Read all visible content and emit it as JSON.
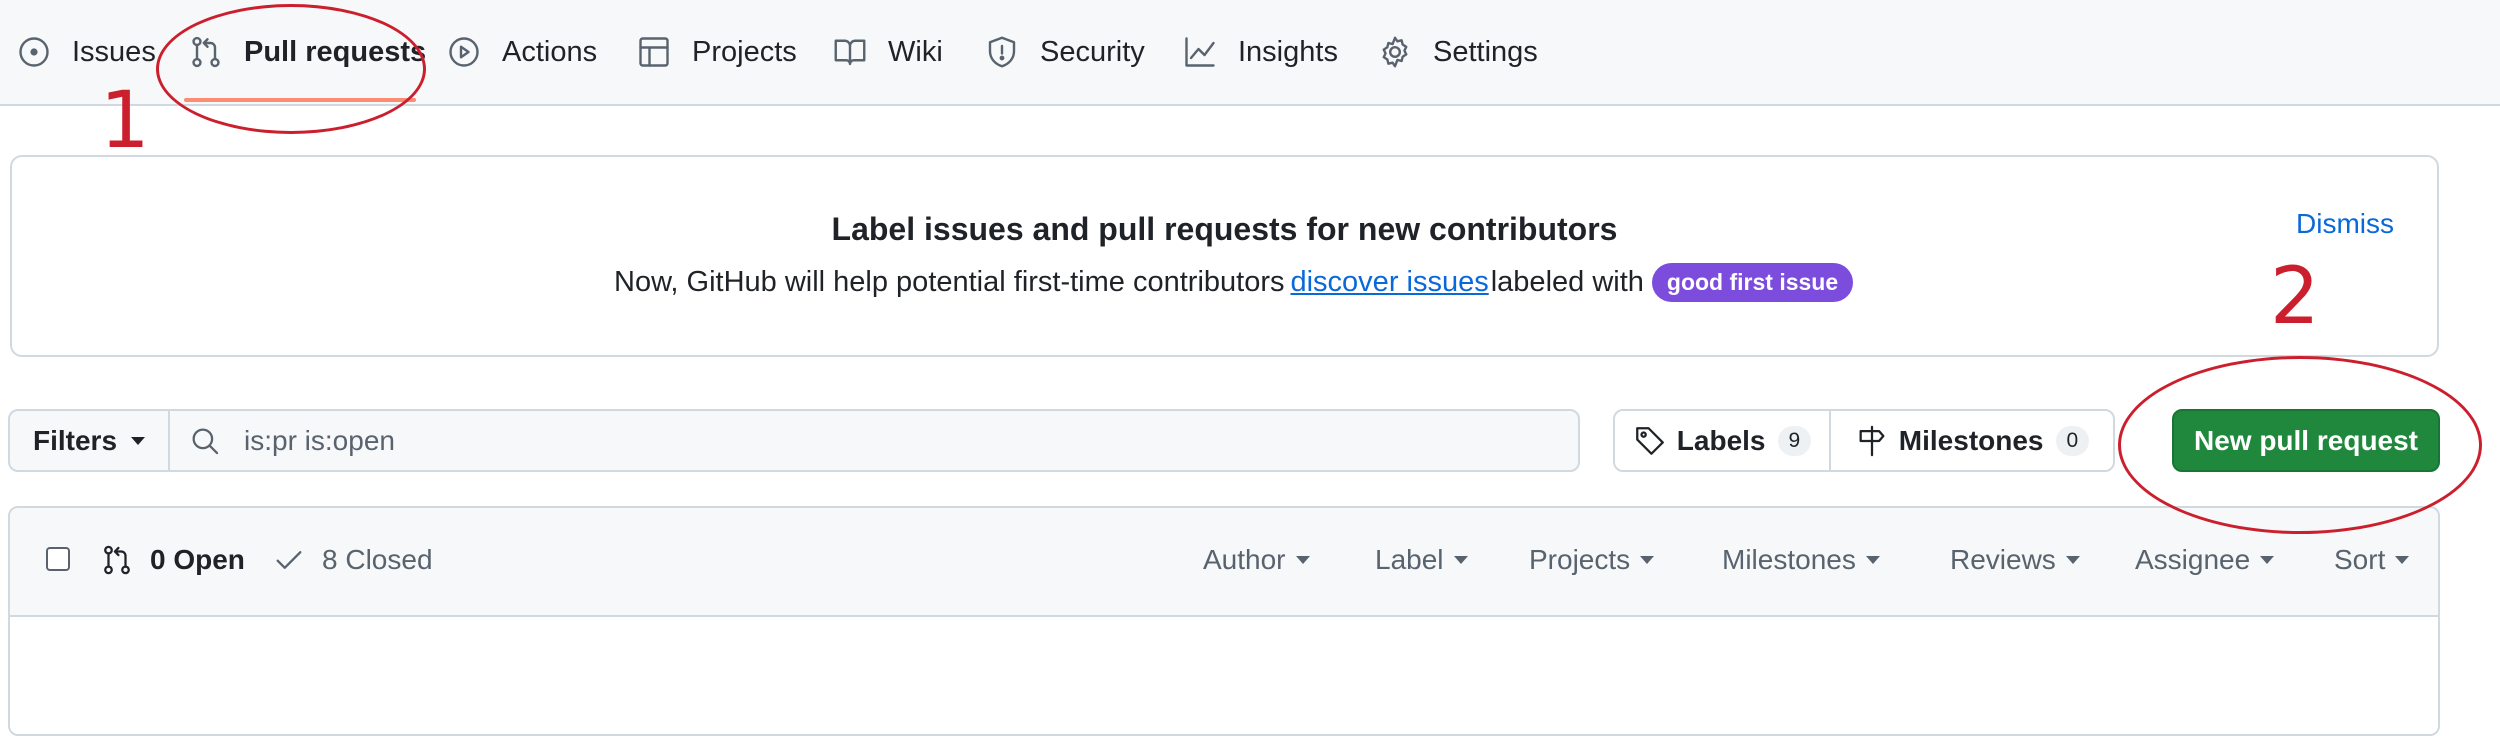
{
  "nav": {
    "tabs": [
      {
        "label": "Issues",
        "icon": "issue-circle-icon"
      },
      {
        "label": "Pull requests",
        "icon": "git-pull-request-icon"
      },
      {
        "label": "Actions",
        "icon": "play-circle-icon"
      },
      {
        "label": "Projects",
        "icon": "table-icon"
      },
      {
        "label": "Wiki",
        "icon": "book-icon"
      },
      {
        "label": "Security",
        "icon": "shield-icon"
      },
      {
        "label": "Insights",
        "icon": "graph-icon"
      },
      {
        "label": "Settings",
        "icon": "gear-icon"
      }
    ],
    "active": "Pull requests",
    "active_underline_color": "#fd8c73"
  },
  "banner": {
    "title": "Label issues and pull requests for new contributors",
    "desc_before": "Now, GitHub will help potential first-time contributors",
    "link": "discover issues",
    "desc_after": "labeled with",
    "pill": "good first issue",
    "pill_color": "#7c4ddc",
    "dismiss": "Dismiss"
  },
  "toolbar": {
    "filters": "Filters",
    "search_value": "is:pr is:open",
    "labels": "Labels",
    "labels_count": "9",
    "milestones": "Milestones",
    "milestones_count": "0",
    "new_pr": "New pull request",
    "new_pr_color": "#1f883d"
  },
  "list": {
    "open": "0 Open",
    "closed": "8 Closed",
    "filters": [
      "Author",
      "Label",
      "Projects",
      "Milestones",
      "Reviews",
      "Assignee",
      "Sort"
    ]
  },
  "annotations": {
    "step1": "1",
    "step2": "2",
    "color": "#cc1f2d"
  }
}
